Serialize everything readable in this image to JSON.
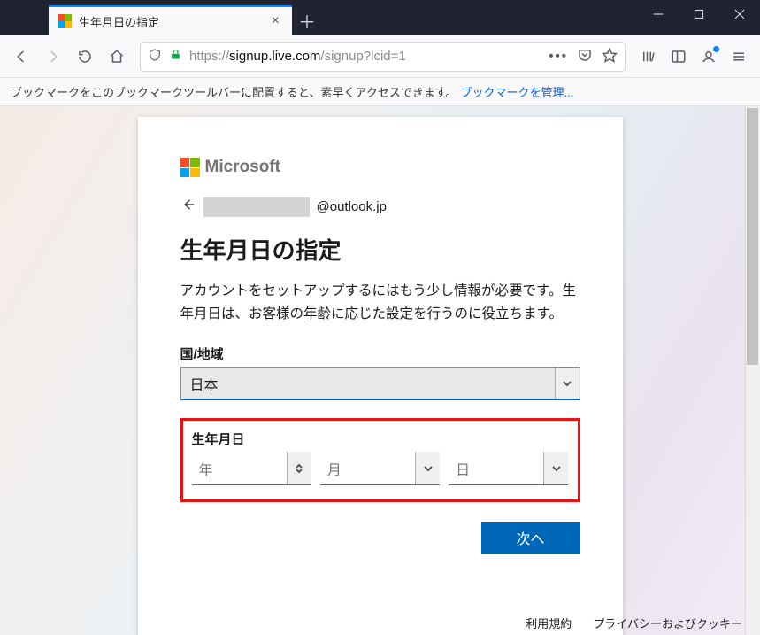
{
  "titlebar": {
    "tab_title": "生年月日の指定"
  },
  "toolbar": {
    "url_prefix": "https://",
    "url_domain": "signup.live.com",
    "url_path": "/signup?lcid=1"
  },
  "bookmark_bar": {
    "hint": "ブックマークをこのブックマークツールバーに配置すると、素早くアクセスできます。",
    "manage_link": "ブックマークを管理..."
  },
  "signup": {
    "brand": "Microsoft",
    "email_domain": "@outlook.jp",
    "heading": "生年月日の指定",
    "description": "アカウントをセットアップするにはもう少し情報が必要です。生年月日は、お客様の年齢に応じた設定を行うのに役立ちます。",
    "country_label": "国/地域",
    "country_value": "日本",
    "dob_label": "生年月日",
    "year_placeholder": "年",
    "month_placeholder": "月",
    "day_placeholder": "日",
    "next_button": "次へ"
  },
  "footer": {
    "terms": "利用規約",
    "privacy": "プライバシーおよびクッキー"
  }
}
